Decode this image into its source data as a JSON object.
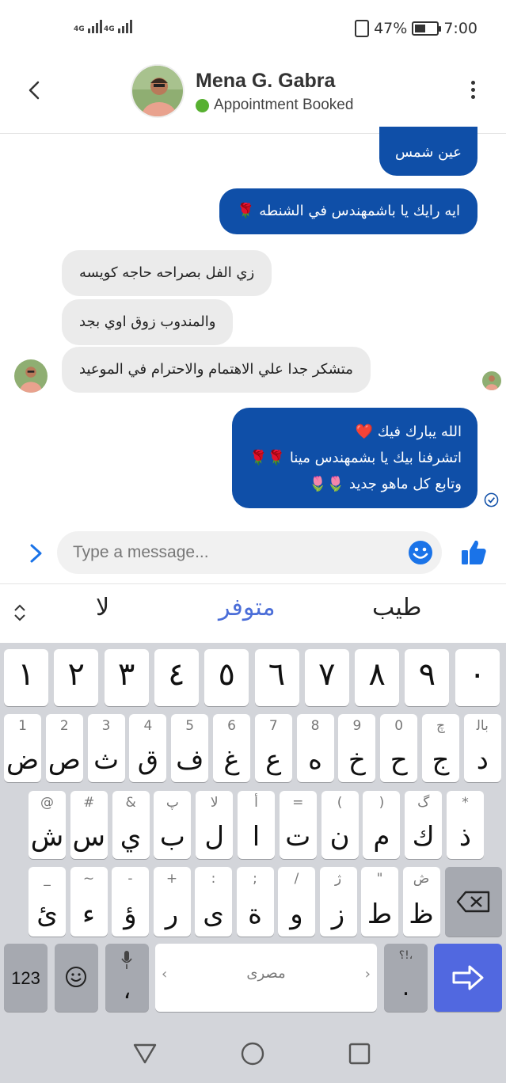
{
  "status_bar": {
    "signal1": "4G",
    "signal2": "4G",
    "battery": "47%",
    "time": "7:00"
  },
  "header": {
    "name": "Mena G. Gabra",
    "status": "Appointment Booked",
    "status_color": "#57b030"
  },
  "messages": [
    {
      "side": "sent",
      "lines": [
        "عين شمس"
      ]
    },
    {
      "side": "sent",
      "lines": [
        "ايه رايك يا باشمهندس في الشنطه 🌹"
      ]
    },
    {
      "side": "received",
      "lines": [
        "زي الفل بصراحه حاجه كويسه"
      ]
    },
    {
      "side": "received",
      "lines": [
        "والمندوب زوق اوي بجد"
      ]
    },
    {
      "side": "received",
      "lines": [
        "متشكر جدا علي الاهتمام والاحترام في الموعيد"
      ]
    },
    {
      "side": "sent",
      "lines": [
        "الله يبارك فيك ❤️",
        "اتشرفنا بيك يا بشمهندس مينا 🌹🌹",
        "وتابع كل ماهو جديد 🌷🌷"
      ]
    }
  ],
  "composer": {
    "placeholder": "Type a message..."
  },
  "suggestions": {
    "left": "لا",
    "middle": "متوفر",
    "right": "طيب"
  },
  "keyboard": {
    "numbers": [
      "١",
      "٢",
      "٣",
      "٤",
      "٥",
      "٦",
      "٧",
      "٨",
      "٩",
      "٠"
    ],
    "row1": [
      {
        "hint": "1",
        "main": "ض"
      },
      {
        "hint": "2",
        "main": "ص"
      },
      {
        "hint": "3",
        "main": "ث"
      },
      {
        "hint": "4",
        "main": "ق"
      },
      {
        "hint": "5",
        "main": "ف"
      },
      {
        "hint": "6",
        "main": "غ"
      },
      {
        "hint": "7",
        "main": "ع"
      },
      {
        "hint": "8",
        "main": "ه"
      },
      {
        "hint": "9",
        "main": "خ"
      },
      {
        "hint": "0",
        "main": "ح"
      },
      {
        "hint": "چ",
        "main": "ج"
      },
      {
        "hint": "ﺑﺎﻟ",
        "main": "د"
      }
    ],
    "row2": [
      {
        "hint": "@",
        "main": "ش"
      },
      {
        "hint": "#",
        "main": "س"
      },
      {
        "hint": "&",
        "main": "ي"
      },
      {
        "hint": "پ",
        "main": "ب"
      },
      {
        "hint": "لا",
        "main": "ل"
      },
      {
        "hint": "أ",
        "main": "ا"
      },
      {
        "hint": "=",
        "main": "ت"
      },
      {
        "hint": "(",
        "main": "ن"
      },
      {
        "hint": ")",
        "main": "م"
      },
      {
        "hint": "گ",
        "main": "ك"
      },
      {
        "hint": "*",
        "main": "ذ"
      }
    ],
    "row3": [
      {
        "hint": "_",
        "main": "ئ"
      },
      {
        "hint": "~",
        "main": "ء"
      },
      {
        "hint": "-",
        "main": "ؤ"
      },
      {
        "hint": "+",
        "main": "ر"
      },
      {
        "hint": ":",
        "main": "ى"
      },
      {
        "hint": ";",
        "main": "ة"
      },
      {
        "hint": "/",
        "main": "و"
      },
      {
        "hint": "ژ",
        "main": "ز"
      },
      {
        "hint": "\"",
        "main": "ط"
      },
      {
        "hint": "ڞ",
        "main": "ظ"
      }
    ],
    "num_toggle": "123",
    "comma_key": "،",
    "space_label": "مصرى",
    "punct_hint": "؟!،",
    "period_key": ".",
    "accent": "#5168e0"
  }
}
